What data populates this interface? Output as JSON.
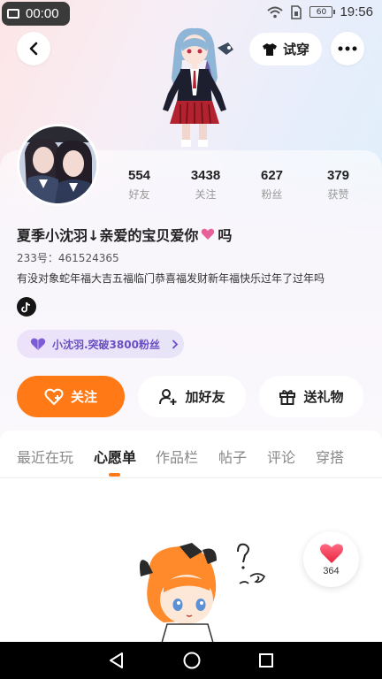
{
  "status_bar": {
    "left_time": "00:00",
    "clock": "19:56",
    "battery": "60"
  },
  "header": {
    "try_on_label": "试穿"
  },
  "profile": {
    "stats": [
      {
        "value": "554",
        "label": "好友"
      },
      {
        "value": "3438",
        "label": "关注"
      },
      {
        "value": "627",
        "label": "粉丝"
      },
      {
        "value": "379",
        "label": "获赞"
      }
    ],
    "name": "夏季小沈羽↓亲爱的宝贝爱你",
    "name_suffix": "吗",
    "id_text": "233号：461524365",
    "bio": "有没对象蛇年福大吉五福临门恭喜福发财新年福快乐过年了过年吗",
    "fan_badge": "小沈羽.突破3800粉丝"
  },
  "actions": {
    "follow": "关注",
    "add_friend": "加好友",
    "gift": "送礼物"
  },
  "tabs": [
    "最近在玩",
    "心愿单",
    "作品栏",
    "帖子",
    "评论",
    "穿搭"
  ],
  "active_tab": "心愿单",
  "like_count": "364",
  "colors": {
    "accent": "#ff7a16",
    "badge_text": "#6a4fc4",
    "heart": "#e8456a"
  }
}
